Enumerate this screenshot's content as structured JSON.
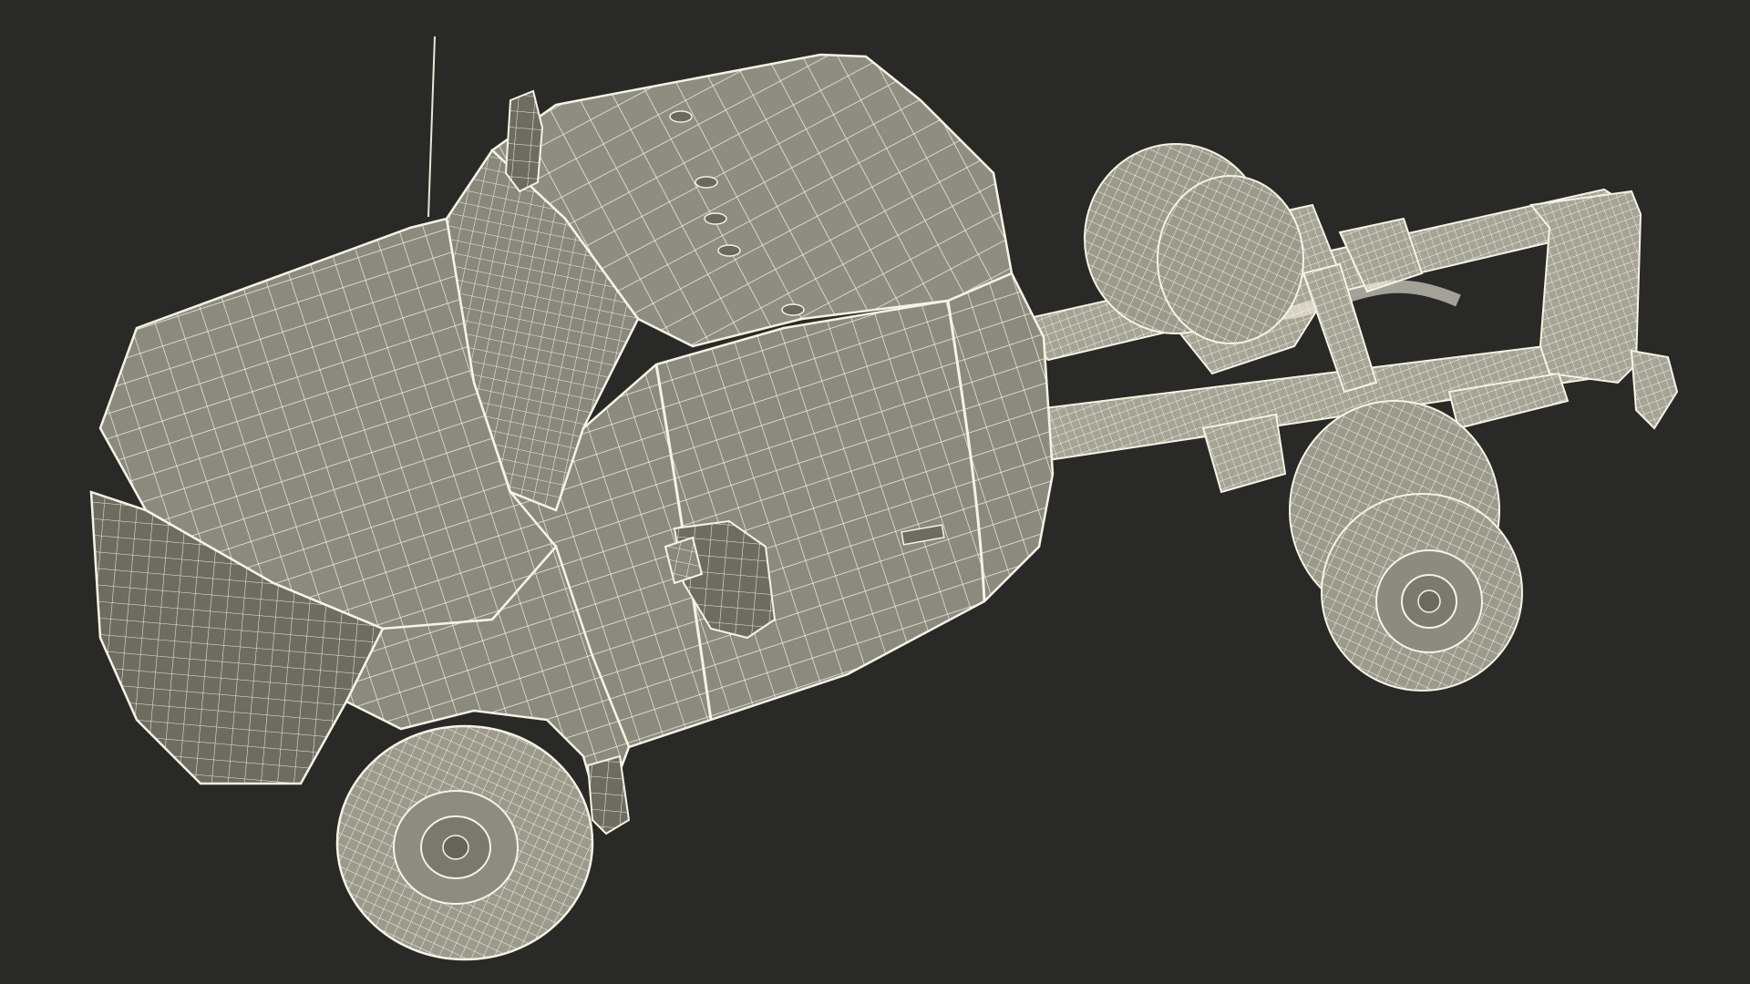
{
  "scene": {
    "subject": "pickup-chassis-cab-wireframe",
    "colors": {
      "background": "#292927",
      "body_fill": "#8e8c80",
      "body_shade": "#6f6d62",
      "body_dark": "#5a584f",
      "wire": "#f4f1e2",
      "tire_fill": "#9a988c",
      "frame_fill": "#a7a598"
    }
  }
}
